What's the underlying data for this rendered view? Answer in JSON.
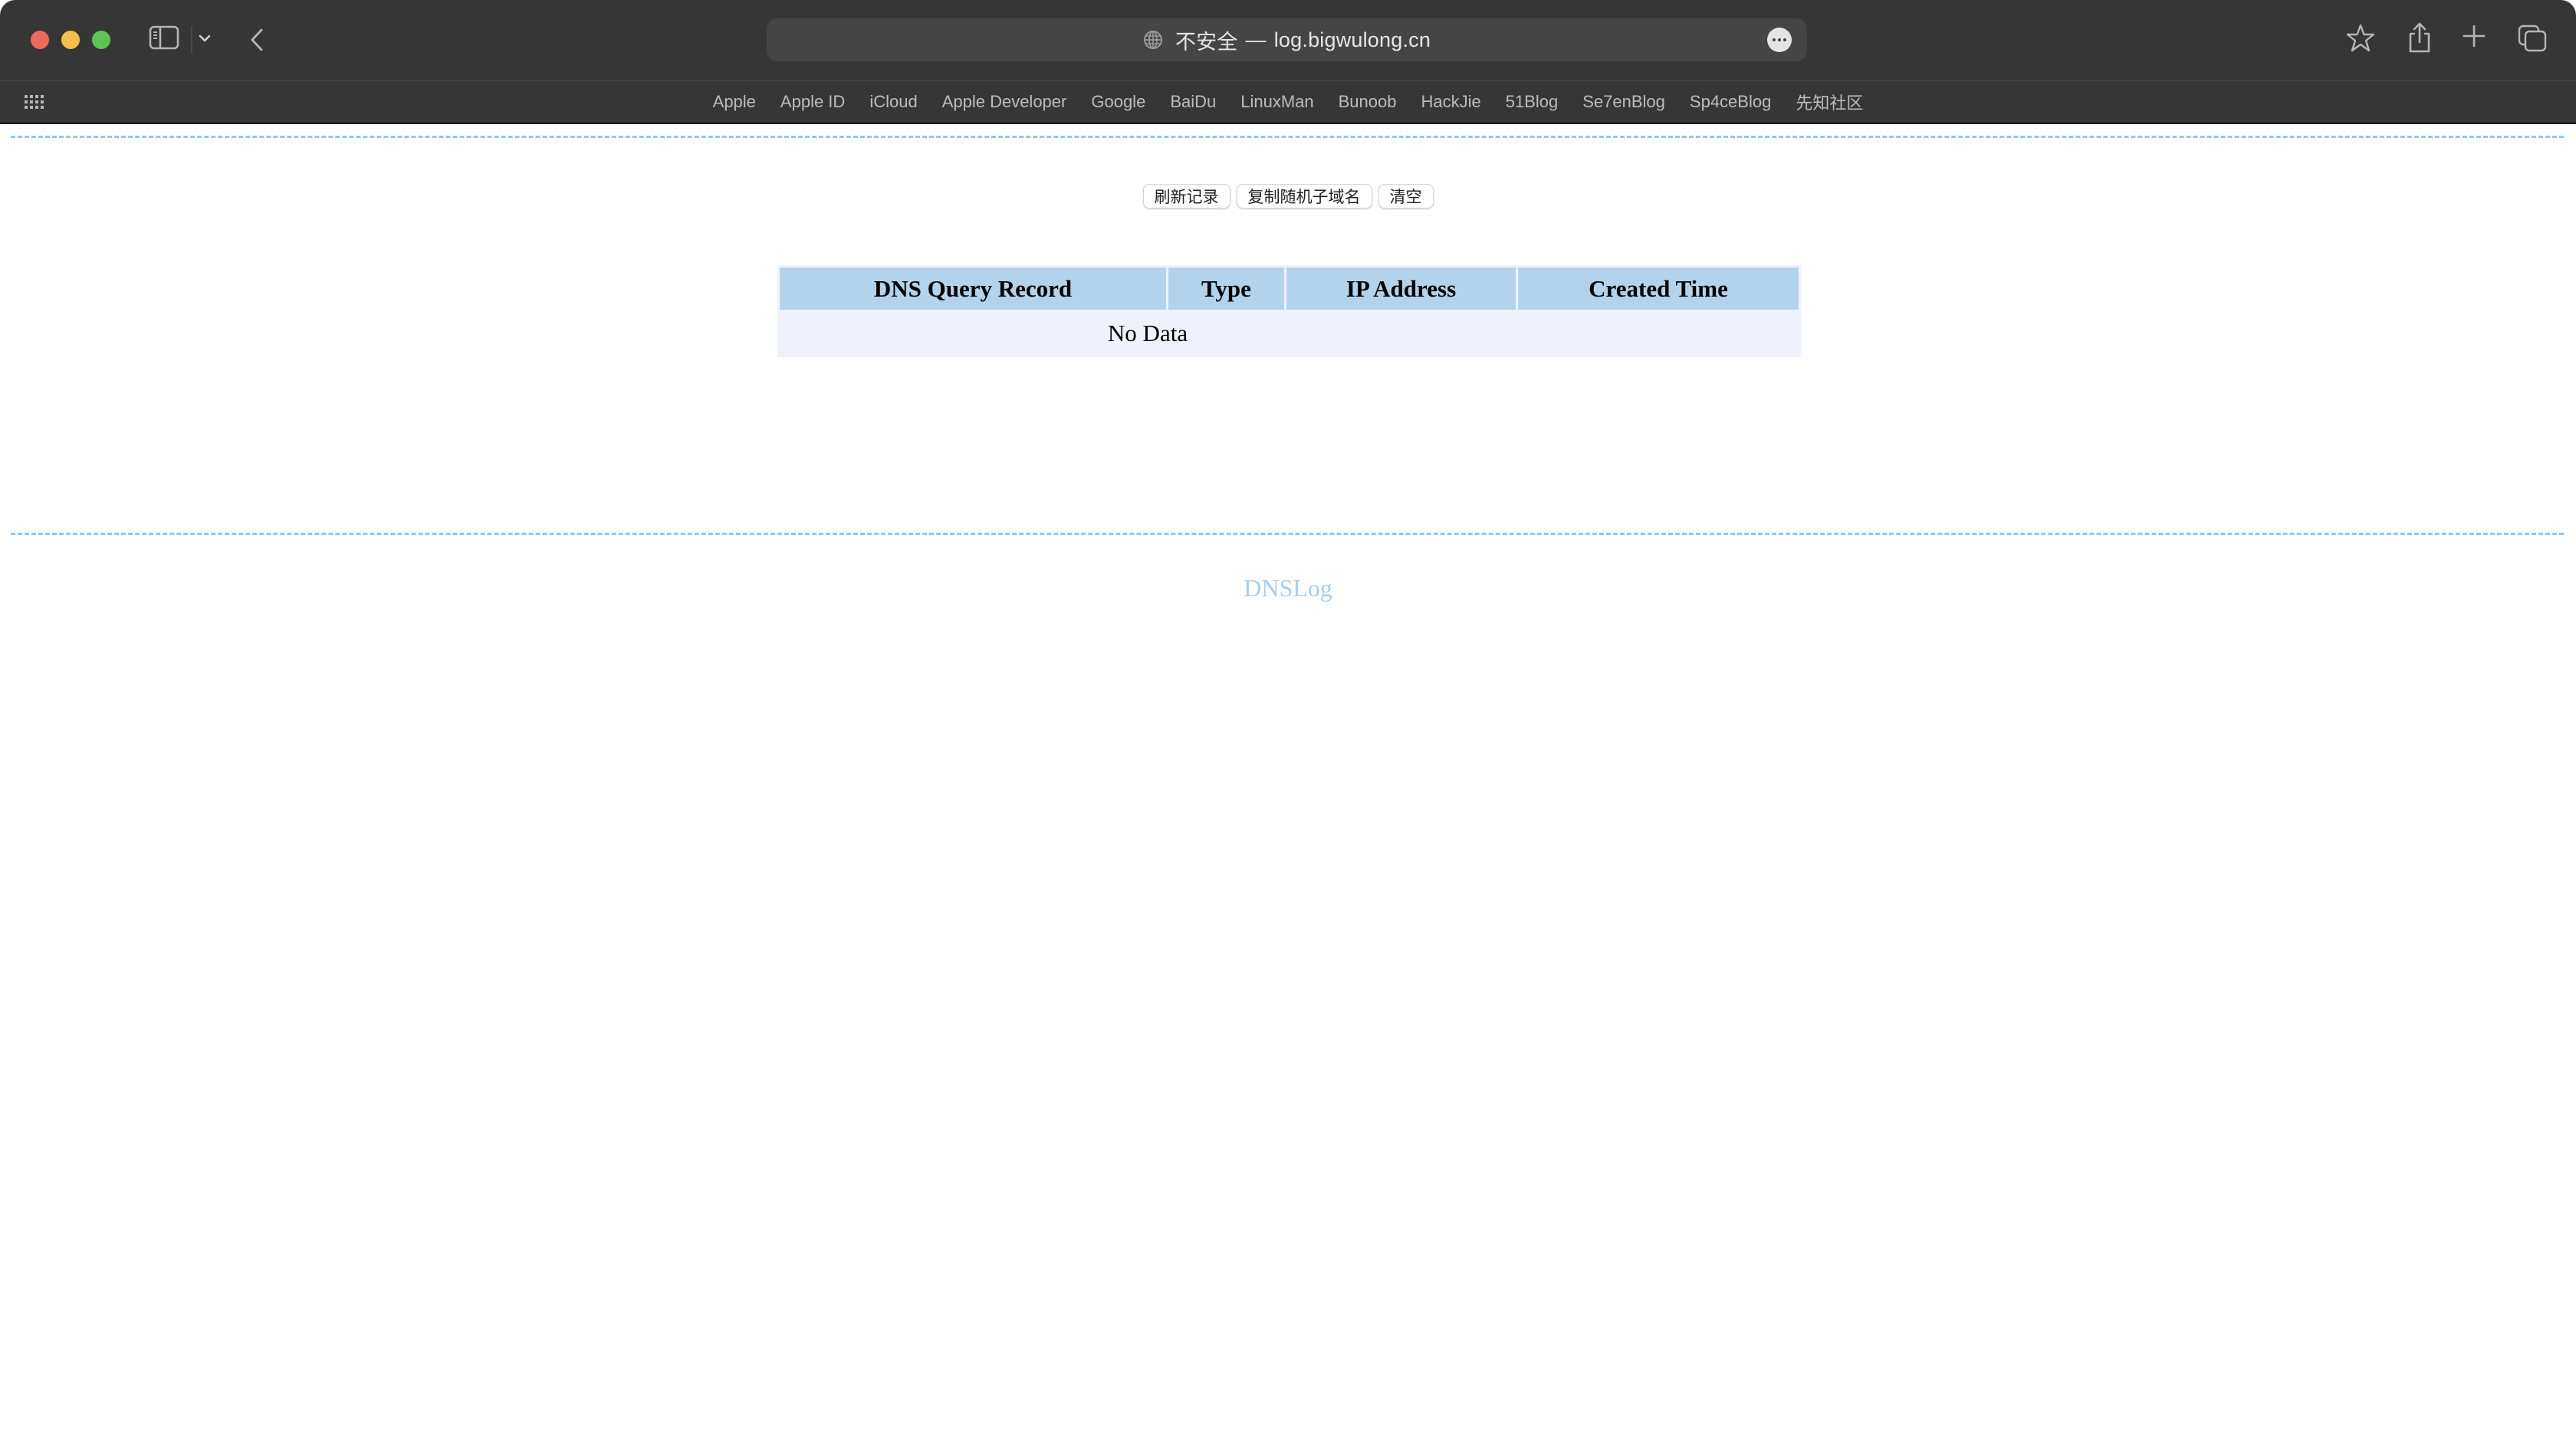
{
  "browser": {
    "url_security_label": "不安全",
    "url_separator": "—",
    "url_domain": "log.bigwulong.cn",
    "icons": {
      "sidebar": "sidebar-icon",
      "chevron": "chevron-down-icon",
      "back": "chevron-left-icon",
      "globe": "globe-icon",
      "more": "ellipsis-circle-icon",
      "bookmark": "star-icon",
      "share": "share-icon",
      "new_tab": "plus-icon",
      "tab_overview": "tabs-icon",
      "favorites_grid": "grid-icon"
    },
    "bookmarks": [
      {
        "label": "Apple"
      },
      {
        "label": "Apple ID"
      },
      {
        "label": "iCloud"
      },
      {
        "label": "Apple Developer"
      },
      {
        "label": "Google"
      },
      {
        "label": "BaiDu"
      },
      {
        "label": "LinuxMan"
      },
      {
        "label": "Bunoob"
      },
      {
        "label": "HackJie"
      },
      {
        "label": "51Blog"
      },
      {
        "label": "Se7enBlog"
      },
      {
        "label": "Sp4ceBlog"
      },
      {
        "label": "先知社区"
      }
    ]
  },
  "page": {
    "buttons": {
      "refresh": "刷新记录",
      "copy_subdomain": "复制随机子域名",
      "clear": "清空"
    },
    "table": {
      "columns": [
        "DNS Query Record",
        "Type",
        "IP Address",
        "Created Time"
      ],
      "empty_message": "No Data",
      "rows": []
    },
    "footer": {
      "brand": "DNSLog"
    },
    "colors": {
      "dash": "#8ec8f0",
      "table_header": "#b3d3ec",
      "table_body": "#eff2fc",
      "footer_text": "#a8cfe9"
    }
  }
}
